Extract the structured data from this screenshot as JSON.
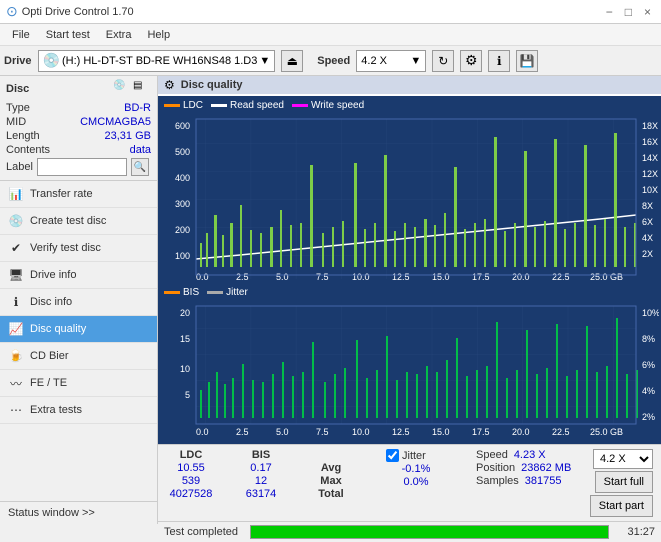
{
  "app": {
    "title": "Opti Drive Control 1.70",
    "min_label": "−",
    "max_label": "□",
    "close_label": "×"
  },
  "menu": {
    "items": [
      "File",
      "Start test",
      "Extra",
      "Help"
    ]
  },
  "drivebar": {
    "drive_label": "Drive",
    "drive_value": "(H:) HL-DT-ST BD-RE  WH16NS48 1.D3",
    "speed_label": "Speed",
    "speed_value": "4.2 X"
  },
  "disc": {
    "header": "Disc",
    "type_label": "Type",
    "type_value": "BD-R",
    "mid_label": "MID",
    "mid_value": "CMCMAGBA5",
    "length_label": "Length",
    "length_value": "23,31 GB",
    "contents_label": "Contents",
    "contents_value": "data",
    "label_label": "Label",
    "label_placeholder": ""
  },
  "sidebar": {
    "items": [
      {
        "id": "transfer-rate",
        "label": "Transfer rate",
        "active": false
      },
      {
        "id": "create-test-disc",
        "label": "Create test disc",
        "active": false
      },
      {
        "id": "verify-test-disc",
        "label": "Verify test disc",
        "active": false
      },
      {
        "id": "drive-info",
        "label": "Drive info",
        "active": false
      },
      {
        "id": "disc-info",
        "label": "Disc info",
        "active": false
      },
      {
        "id": "disc-quality",
        "label": "Disc quality",
        "active": true
      },
      {
        "id": "cd-bier",
        "label": "CD Bier",
        "active": false
      },
      {
        "id": "fe-te",
        "label": "FE / TE",
        "active": false
      },
      {
        "id": "extra-tests",
        "label": "Extra tests",
        "active": false
      }
    ],
    "status_window": "Status window >>"
  },
  "quality_panel": {
    "title": "Disc quality",
    "legend": {
      "ldc_label": "LDC",
      "read_speed_label": "Read speed",
      "write_speed_label": "Write speed"
    },
    "legend2": {
      "bis_label": "BIS",
      "jitter_label": "Jitter"
    }
  },
  "upper_chart": {
    "y_left_labels": [
      "600",
      "500",
      "400",
      "300",
      "200",
      "100"
    ],
    "y_right_labels": [
      "18X",
      "16X",
      "14X",
      "12X",
      "10X",
      "8X",
      "6X",
      "4X",
      "2X"
    ],
    "x_labels": [
      "0.0",
      "2.5",
      "5.0",
      "7.5",
      "10.0",
      "12.5",
      "15.0",
      "17.5",
      "20.0",
      "22.5",
      "25.0 GB"
    ]
  },
  "lower_chart": {
    "y_left_labels": [
      "20",
      "15",
      "10",
      "5"
    ],
    "y_right_labels": [
      "10%",
      "8%",
      "6%",
      "4%",
      "2%"
    ],
    "x_labels": [
      "0.0",
      "2.5",
      "5.0",
      "7.5",
      "10.0",
      "12.5",
      "15.0",
      "17.5",
      "20.0",
      "22.5",
      "25.0 GB"
    ]
  },
  "stats": {
    "ldc_header": "LDC",
    "bis_header": "BIS",
    "jitter_header": "Jitter",
    "jitter_checked": true,
    "avg_label": "Avg",
    "max_label": "Max",
    "total_label": "Total",
    "ldc_avg": "10.55",
    "ldc_max": "539",
    "ldc_total": "4027528",
    "bis_avg": "0.17",
    "bis_max": "12",
    "bis_total": "63174",
    "jitter_avg": "-0.1%",
    "jitter_max": "0.0%",
    "jitter_total": "",
    "speed_label": "Speed",
    "speed_value": "4.23 X",
    "speed_dropdown": "4.2 X",
    "position_label": "Position",
    "position_value": "23862 MB",
    "samples_label": "Samples",
    "samples_value": "381755",
    "start_full_label": "Start full",
    "start_part_label": "Start part"
  },
  "progress": {
    "status": "Test completed",
    "percent": 100,
    "time": "31:27"
  }
}
